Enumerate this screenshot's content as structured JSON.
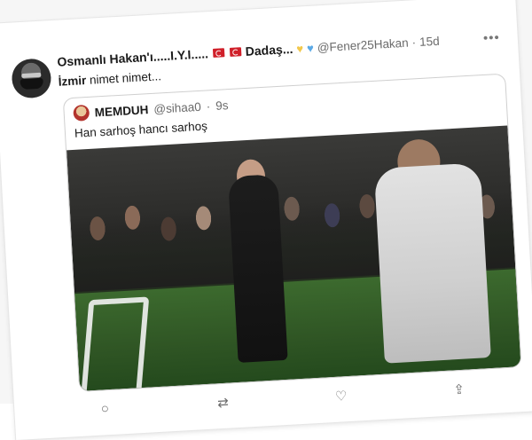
{
  "tweet": {
    "author_display": "Osmanlı Hakan'ı.....I.Y.I.....",
    "author_display_suffix": "Dadaş...",
    "handle": "@Fener25Hakan",
    "separator": "·",
    "time": "15d",
    "text_bold": "İzmir",
    "text_rest": " nimet nimet...",
    "icons": {
      "avatar": "avatar",
      "more": "more-horizontal-icon",
      "flags": "turkish-flag-icon",
      "hearts": [
        "yellow-heart-icon",
        "blue-heart-icon"
      ]
    },
    "colors": {
      "yellow_heart": "#f2c84b",
      "blue_heart": "#5aa9e6"
    }
  },
  "quote": {
    "author_name": "MEMDUH",
    "handle": "@sihaa0",
    "separator": "·",
    "time": "9s",
    "text": "Han sarhoş hancı sarhoş"
  },
  "actions": {
    "reply_icon": "reply-icon",
    "retweet_icon": "retweet-icon",
    "like_icon": "like-heart-icon",
    "share_icon": "share-icon"
  }
}
